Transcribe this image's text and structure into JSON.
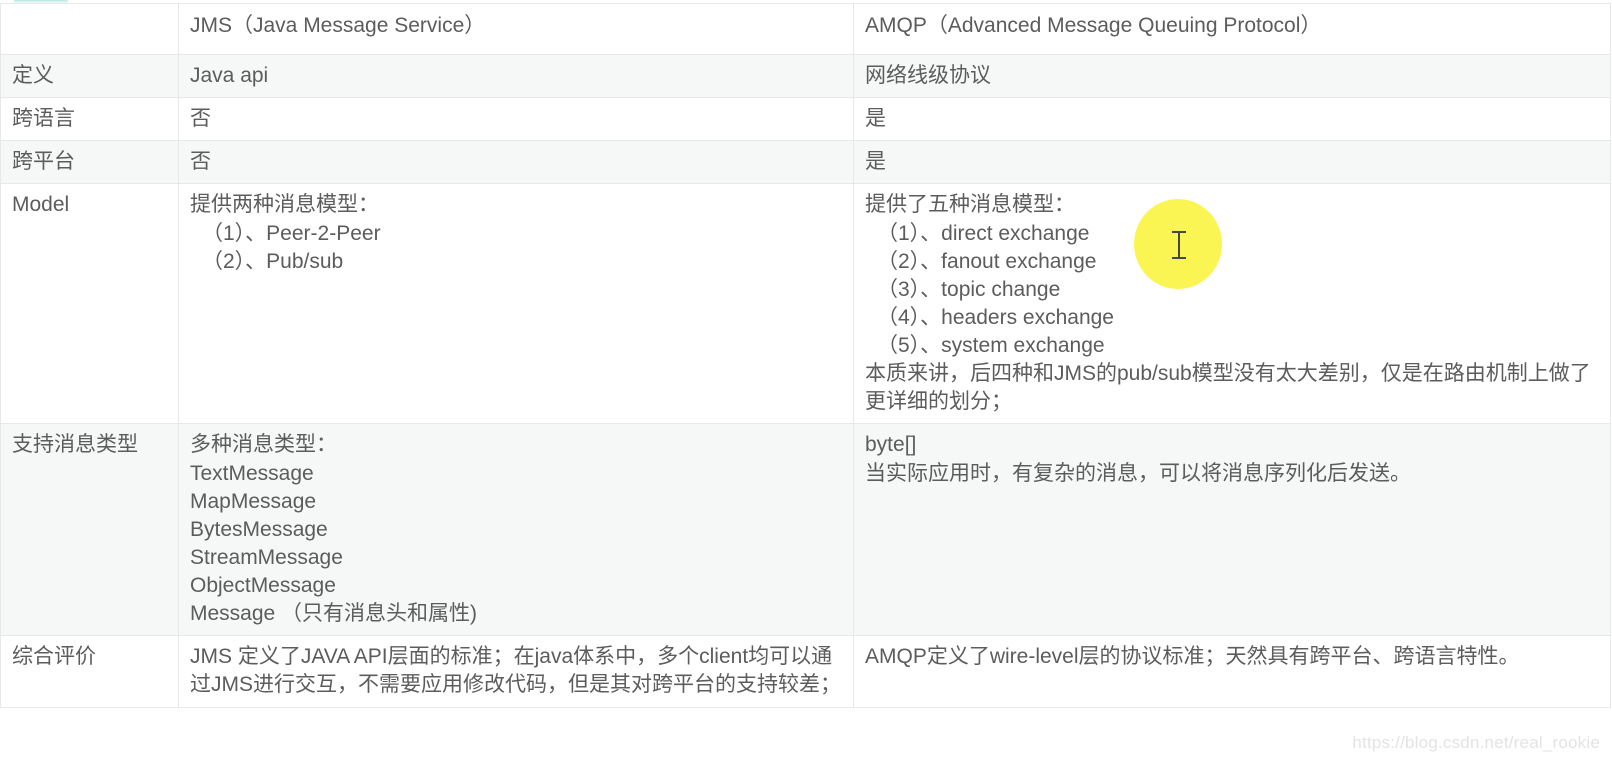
{
  "table": {
    "columns": [
      "",
      "JMS（Java Message Service）",
      "AMQP（Advanced Message Queuing Protocol）"
    ],
    "headers": {
      "blank": "",
      "jms": "JMS（Java Message Service）",
      "amqp": "AMQP（Advanced Message Queuing Protocol）"
    },
    "rows": [
      {
        "label": "定义",
        "jms": "Java api",
        "amqp": "网络线级协议"
      },
      {
        "label": "跨语言",
        "jms": "否",
        "amqp": "是"
      },
      {
        "label": "跨平台",
        "jms": "否",
        "amqp": "是"
      },
      {
        "label": "Model",
        "jms_lines": [
          "提供两种消息模型：",
          "（1）、Peer-2-Peer",
          "（2）、Pub/sub"
        ],
        "amqp_lines": [
          "提供了五种消息模型：",
          "（1）、direct exchange",
          "（2）、fanout exchange",
          "（3）、topic change",
          "（4）、headers exchange",
          "（5）、system exchange"
        ],
        "amqp_note": "本质来讲，后四种和JMS的pub/sub模型没有太大差别，仅是在路由机制上做了更详细的划分；"
      },
      {
        "label": "支持消息类型",
        "jms_lines": [
          "多种消息类型：",
          "TextMessage",
          "MapMessage",
          "BytesMessage",
          "StreamMessage",
          "ObjectMessage",
          "Message （只有消息头和属性)"
        ],
        "amqp_lines": [
          "byte[]",
          "当实际应用时，有复杂的消息，可以将消息序列化后发送。"
        ]
      },
      {
        "label": "综合评价",
        "jms": "JMS 定义了JAVA API层面的标准；在java体系中，多个client均可以通过JMS进行交互，不需要应用修改代码，但是其对跨平台的支持较差；",
        "amqp": "AMQP定义了wire-level层的协议标准；天然具有跨平台、跨语言特性。"
      }
    ]
  },
  "watermark": {
    "text": "https://blog.csdn.net/real_rookie"
  },
  "cursor": {
    "type": "text-ibeam",
    "highlight_color": "#fbf43c"
  },
  "colors": {
    "text": "#5c5c5c",
    "border": "#e7e9e9",
    "stripe_bg": "#f6f7f7",
    "plain_bg": "#ffffff",
    "focus_border": "#3f4548",
    "watermark": "#e3e3e3"
  }
}
